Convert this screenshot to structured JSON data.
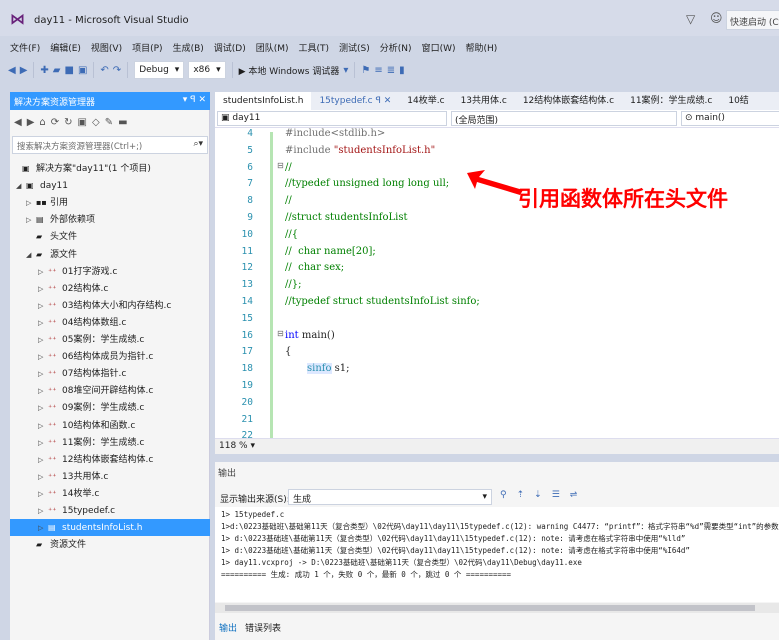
{
  "window": {
    "title": "day11 - Microsoft Visual Studio",
    "quick_launch": "快速启动 (Ctrl+Q)"
  },
  "menu": [
    "文件(F)",
    "编辑(E)",
    "视图(V)",
    "项目(P)",
    "生成(B)",
    "调试(D)",
    "团队(M)",
    "工具(T)",
    "测试(S)",
    "分析(N)",
    "窗口(W)",
    "帮助(H)"
  ],
  "toolbar": {
    "config": "Debug",
    "platform": "x86",
    "run_label": "▶ 本地 Windows 调试器"
  },
  "solution_explorer": {
    "header": "解决方案资源管理器",
    "header_icons": "▾ ꟼ ✕",
    "search_placeholder": "搜索解决方案资源管理器(Ctrl+;)",
    "solution": "解决方案\"day11\"(1 个项目)",
    "project": "day11",
    "nodes": [
      {
        "label": "引用",
        "level": 1,
        "arrow": "▷",
        "icon": "▪▪"
      },
      {
        "label": "外部依赖项",
        "level": 1,
        "arrow": "▷",
        "icon": "▤"
      },
      {
        "label": "头文件",
        "level": 1,
        "arrow": "",
        "icon": "▰"
      },
      {
        "label": "源文件",
        "level": 1,
        "arrow": "◢",
        "icon": "▰"
      }
    ],
    "files": [
      "01打字游戏.c",
      "02结构体.c",
      "03结构体大小和内存结构.c",
      "04结构体数组.c",
      "05案例：学生成绩.c",
      "06结构体成员为指针.c",
      "07结构体指针.c",
      "08堆空间开辟结构体.c",
      "09案例：学生成绩.c",
      "10结构体和函数.c",
      "11案例：学生成绩.c",
      "12结构体嵌套结构体.c",
      "13共用体.c",
      "14枚举.c",
      "15typedef.c"
    ],
    "selected_file": "studentsInfoList.h",
    "resources": "资源文件"
  },
  "editor": {
    "tabs": [
      "studentsInfoList.h",
      "15typedef.c",
      "14枚举.c",
      "13共用体.c",
      "12结构体嵌套结构体.c",
      "11案例：学生成绩.c",
      "10结"
    ],
    "tab_close": "ꟼ ✕",
    "nav_project": "day11",
    "nav_scope": "(全局范围)",
    "nav_member": "main()",
    "line_numbers": [
      "4",
      "5",
      "6",
      "7",
      "8",
      "9",
      "10",
      "11",
      "12",
      "13",
      "14",
      "15",
      "16",
      "17",
      "18",
      "19",
      "20",
      "21",
      "22"
    ],
    "zoom": "118 %",
    "annotation": "引用函数体所在头文件"
  },
  "code": {
    "l4": "#include<stdlib.h>",
    "l5a": "#include ",
    "l5b": "\"studentsInfoList.h\"",
    "l6": "//",
    "l7": "//typedef unsigned long long ull;",
    "l8": "//",
    "l9": "//struct studentsInfoList",
    "l10": "//{",
    "l11": "//  char name[20];",
    "l12": "//  char sex;",
    "l13": "//};",
    "l14": "//typedef struct studentsInfoList sinfo;",
    "l16a": "int",
    "l16b": " main()",
    "l17": "{",
    "l18a": "sinfo",
    "l18b": " s1;"
  },
  "output": {
    "header": "输出",
    "source_label": "显示输出来源(S):",
    "source_value": "生成",
    "lines": [
      "1>  15typedef.c",
      "1>d:\\0223基础班\\基础第11天（复合类型）\\02代码\\day11\\day11\\15typedef.c(12): warning C4477: “printf”：格式字符串“%d”需要类型“int”的参数",
      "1>  d:\\0223基础班\\基础第11天（复合类型）\\02代码\\day11\\day11\\15typedef.c(12): note: 请考虑在格式字符串中使用“%lld”",
      "1>  d:\\0223基础班\\基础第11天（复合类型）\\02代码\\day11\\day11\\15typedef.c(12): note: 请考虑在格式字符串中使用“%I64d”",
      "1>  day11.vcxproj -> D:\\0223基础班\\基础第11天（复合类型）\\02代码\\day11\\Debug\\day11.exe",
      "========== 生成: 成功 1 个，失败 0 个，最新 0 个，跳过 0 个 =========="
    ],
    "tabs": [
      "输出",
      "错误列表"
    ]
  }
}
